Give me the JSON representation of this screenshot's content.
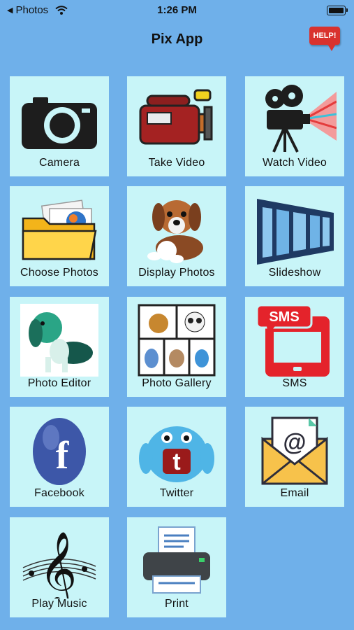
{
  "status_bar": {
    "back_app": "Photos",
    "time": "1:26 PM"
  },
  "app": {
    "title": "Pix App",
    "help_label": "HELP!"
  },
  "tiles": [
    {
      "label": "Camera",
      "icon": "camera-icon"
    },
    {
      "label": "Take Video",
      "icon": "video-camera-icon"
    },
    {
      "label": "Watch Video",
      "icon": "film-projector-icon"
    },
    {
      "label": "Choose Photos",
      "icon": "folder-icon"
    },
    {
      "label": "Display Photos",
      "icon": "puppy-icon"
    },
    {
      "label": "Slideshow",
      "icon": "film-strip-icon"
    },
    {
      "label": "Photo Editor",
      "icon": "edited-dog-icon"
    },
    {
      "label": "Photo Gallery",
      "icon": "gallery-grid-icon"
    },
    {
      "label": "SMS",
      "icon": "sms-phone-icon"
    },
    {
      "label": "Facebook",
      "icon": "facebook-egg-icon"
    },
    {
      "label": "Twitter",
      "icon": "twitter-monster-icon"
    },
    {
      "label": "Email",
      "icon": "email-envelope-icon"
    },
    {
      "label": "Play Music",
      "icon": "treble-clef-icon"
    },
    {
      "label": "Print",
      "icon": "printer-icon"
    }
  ]
}
